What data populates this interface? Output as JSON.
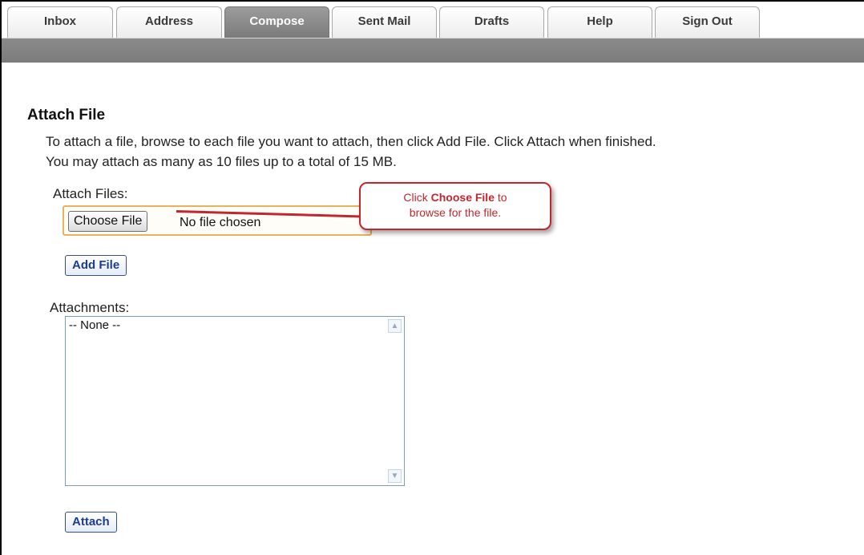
{
  "nav": {
    "tabs": [
      {
        "label": "Inbox"
      },
      {
        "label": "Address"
      },
      {
        "label": "Compose"
      },
      {
        "label": "Sent Mail"
      },
      {
        "label": "Drafts"
      },
      {
        "label": "Help"
      },
      {
        "label": "Sign Out"
      }
    ],
    "active_tab": "Compose"
  },
  "page": {
    "title": "Attach File",
    "instructions_line1": "To attach a file, browse to each file you want to attach, then click Add File. Click Attach when finished.",
    "instructions_line2": "You may attach as many as 10 files up to a total of 15 MB."
  },
  "attach_files": {
    "label": "Attach Files:",
    "choose_button": "Choose File",
    "file_status": "No file chosen",
    "add_button": "Add File"
  },
  "attachments": {
    "label": "Attachments:",
    "items": [
      "-- None --"
    ],
    "attach_button": "Attach"
  },
  "callout": {
    "prefix": "Click ",
    "emphasis": "Choose File",
    "suffix_line1": " to",
    "line2": "browse for the file.",
    "color": "#c1272d"
  },
  "colors": {
    "active_tab": "#8a8a8a",
    "button_text": "#1b3d91",
    "file_highlight": "#e8b35a"
  }
}
